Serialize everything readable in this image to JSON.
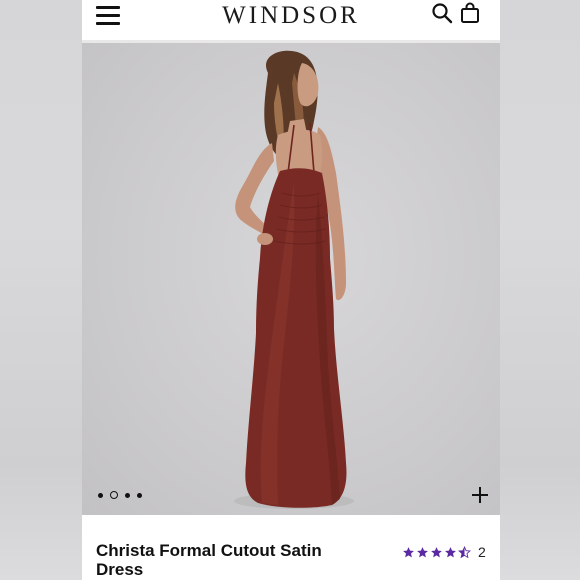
{
  "header": {
    "brand": "WINDSOR",
    "menu_icon": "hamburger-menu-icon",
    "search_icon": "search-icon",
    "bag_icon": "shopping-bag-icon"
  },
  "gallery": {
    "image_count": 4,
    "active_index": 1,
    "zoom_icon": "plus-icon",
    "dress_color": "#7a2a24",
    "background_color": "#cbcacc"
  },
  "product": {
    "title": "Christa Formal Cutout Satin Dress",
    "rating": 4.5,
    "review_count": "2",
    "star_color": "#5b2aa3"
  }
}
